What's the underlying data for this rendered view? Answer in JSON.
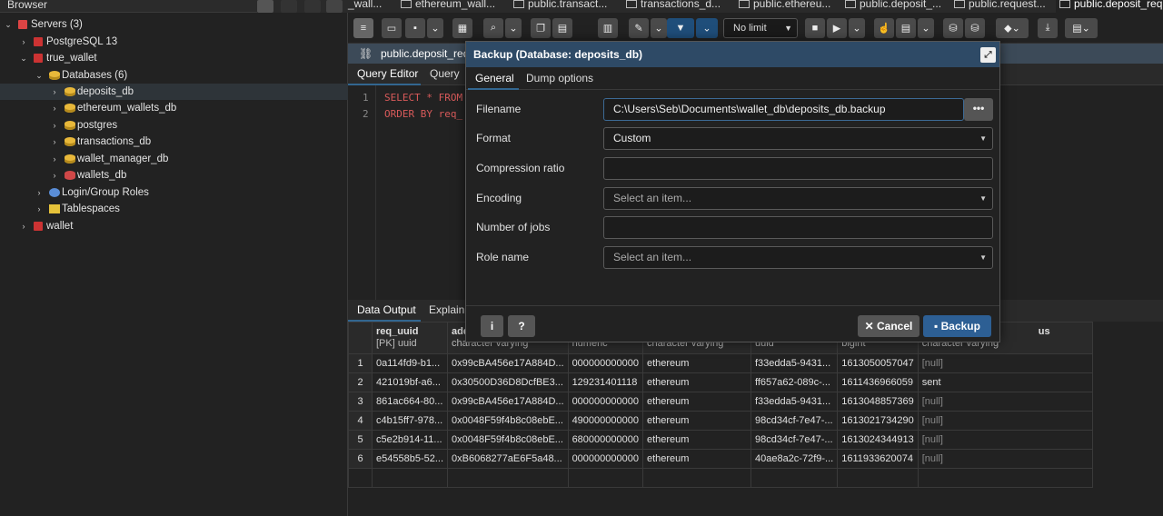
{
  "sidebar": {
    "title": "Browser",
    "tree": [
      {
        "label": "Servers (3)",
        "icon": "servers-icon"
      },
      {
        "label": "PostgreSQL 13",
        "icon": "server-icon"
      },
      {
        "label": "true_wallet",
        "icon": "server-icon"
      },
      {
        "label": "Databases (6)",
        "icon": "databases-icon"
      },
      {
        "label": "deposits_db",
        "icon": "database-icon"
      },
      {
        "label": "ethereum_wallets_db",
        "icon": "database-icon"
      },
      {
        "label": "postgres",
        "icon": "database-icon"
      },
      {
        "label": "transactions_db",
        "icon": "database-icon"
      },
      {
        "label": "wallet_manager_db",
        "icon": "database-icon"
      },
      {
        "label": "wallets_db",
        "icon": "database-icon"
      },
      {
        "label": "Login/Group Roles",
        "icon": "roles-icon"
      },
      {
        "label": "Tablespaces",
        "icon": "tablespaces-icon"
      },
      {
        "label": "wallet",
        "icon": "server-icon"
      }
    ]
  },
  "tabs": [
    "_wall...",
    "ethereum_wall...",
    "public.transact...",
    "transactions_d...",
    "public.ethereu...",
    "public.deposit_...",
    "public.request...",
    "public.deposit_req"
  ],
  "toolbar": {
    "limit": "No limit"
  },
  "query": {
    "title": "public.deposit_req",
    "tabs": [
      "Query Editor",
      "Query H"
    ],
    "lines": [
      {
        "n": "1",
        "code": "SELECT * FROM"
      },
      {
        "n": "2",
        "code": "ORDER BY req_"
      }
    ]
  },
  "output": {
    "tabs": [
      "Data Output",
      "Explain"
    ],
    "columns": [
      {
        "name": "",
        "type": ""
      },
      {
        "name": "req_uuid",
        "type": "[PK] uuid"
      },
      {
        "name": "addr",
        "type": "character varying"
      },
      {
        "name": "",
        "type": "numeric"
      },
      {
        "name": "",
        "type": "character varying"
      },
      {
        "name": "",
        "type": "uuid"
      },
      {
        "name": "",
        "type": "bigint"
      },
      {
        "name": "us",
        "type": "character varying"
      }
    ],
    "rows": [
      [
        "1",
        "0a114fd9-b1...",
        "0x99cBA456e17A884D...",
        "000000000000",
        "ethereum",
        "f33edda5-9431...",
        "1613050057047",
        "[null]"
      ],
      [
        "2",
        "421019bf-a6...",
        "0x30500D36D8DcfBE3...",
        "129231401118",
        "ethereum",
        "ff657a62-089c-...",
        "1611436966059",
        "sent"
      ],
      [
        "3",
        "861ac664-80...",
        "0x99cBA456e17A884D...",
        "000000000000",
        "ethereum",
        "f33edda5-9431...",
        "1613048857369",
        "[null]"
      ],
      [
        "4",
        "c4b15ff7-978...",
        "0x0048F59f4b8c08ebE...",
        "490000000000",
        "ethereum",
        "98cd34cf-7e47-...",
        "1613021734290",
        "[null]"
      ],
      [
        "5",
        "c5e2b914-11...",
        "0x0048F59f4b8c08ebE...",
        "680000000000",
        "ethereum",
        "98cd34cf-7e47-...",
        "1613024344913",
        "[null]"
      ],
      [
        "6",
        "e54558b5-52...",
        "0xB6068277aE6F5a48...",
        "000000000000",
        "ethereum",
        "40ae8a2c-72f9-...",
        "1611933620074",
        "[null]"
      ]
    ]
  },
  "dialog": {
    "title": "Backup (Database: deposits_db)",
    "tabs": [
      "General",
      "Dump options"
    ],
    "fields": {
      "filename": {
        "label": "Filename",
        "value": "C:\\Users\\Seb\\Documents\\wallet_db\\deposits_db.backup"
      },
      "format": {
        "label": "Format",
        "value": "Custom"
      },
      "compression": {
        "label": "Compression ratio",
        "value": ""
      },
      "encoding": {
        "label": "Encoding",
        "placeholder": "Select an item..."
      },
      "jobs": {
        "label": "Number of jobs",
        "value": ""
      },
      "role": {
        "label": "Role name",
        "placeholder": "Select an item..."
      }
    },
    "browse": "•••",
    "info": "i",
    "help": "?",
    "cancel": "✕ Cancel",
    "backup": "Backup"
  }
}
